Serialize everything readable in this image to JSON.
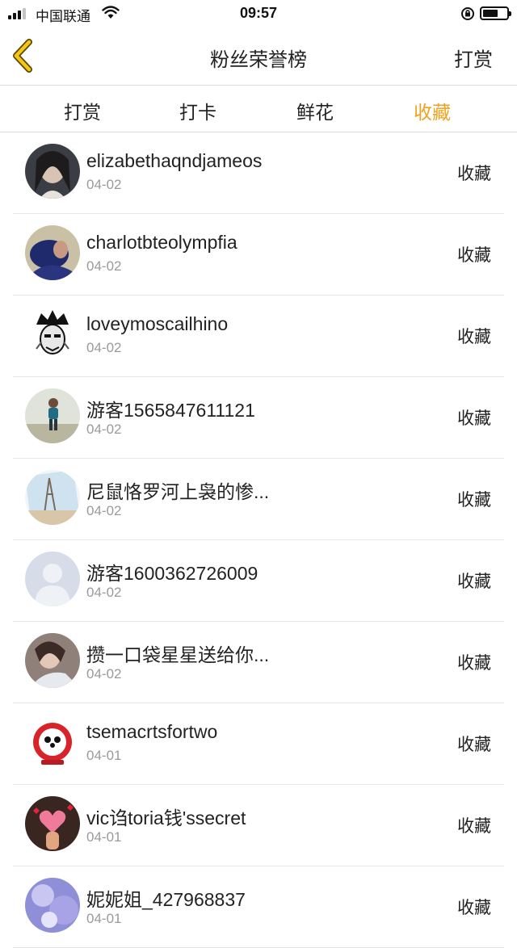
{
  "status": {
    "carrier": "中国联通",
    "time": "09:57"
  },
  "nav": {
    "title": "粉丝荣誉榜",
    "right_label": "打赏"
  },
  "tabs": [
    {
      "label": "打赏"
    },
    {
      "label": "打卡"
    },
    {
      "label": "鲜花"
    },
    {
      "label": "收藏"
    }
  ],
  "active_tab": "收藏",
  "colors": {
    "accent": "#f0a21f",
    "text": "#222222",
    "secondary": "#9a9a9a",
    "divider": "#e6e6e6"
  },
  "fans": [
    {
      "name": "elizabethaqndjameos",
      "date": "04-02",
      "action": "收藏"
    },
    {
      "name": "charlotbteolympfia",
      "date": "04-02",
      "action": "收藏"
    },
    {
      "name": "loveymoscailhino",
      "date": "04-02",
      "action": "收藏"
    },
    {
      "name": "游客1565847611121",
      "date": "04-02",
      "action": "收藏"
    },
    {
      "name": "尼鼠恪罗河上袅的惨...",
      "date": "04-02",
      "action": "收藏"
    },
    {
      "name": "游客1600362726009",
      "date": "04-02",
      "action": "收藏"
    },
    {
      "name": "攒一口袋星星送给你...",
      "date": "04-02",
      "action": "收藏"
    },
    {
      "name": "tsemacrtsfortwo",
      "date": "04-01",
      "action": "收藏"
    },
    {
      "name": "vic诌toria钱'ssecret",
      "date": "04-01",
      "action": "收藏"
    },
    {
      "name": "妮妮姐_427968837",
      "date": "04-01",
      "action": "收藏"
    }
  ]
}
